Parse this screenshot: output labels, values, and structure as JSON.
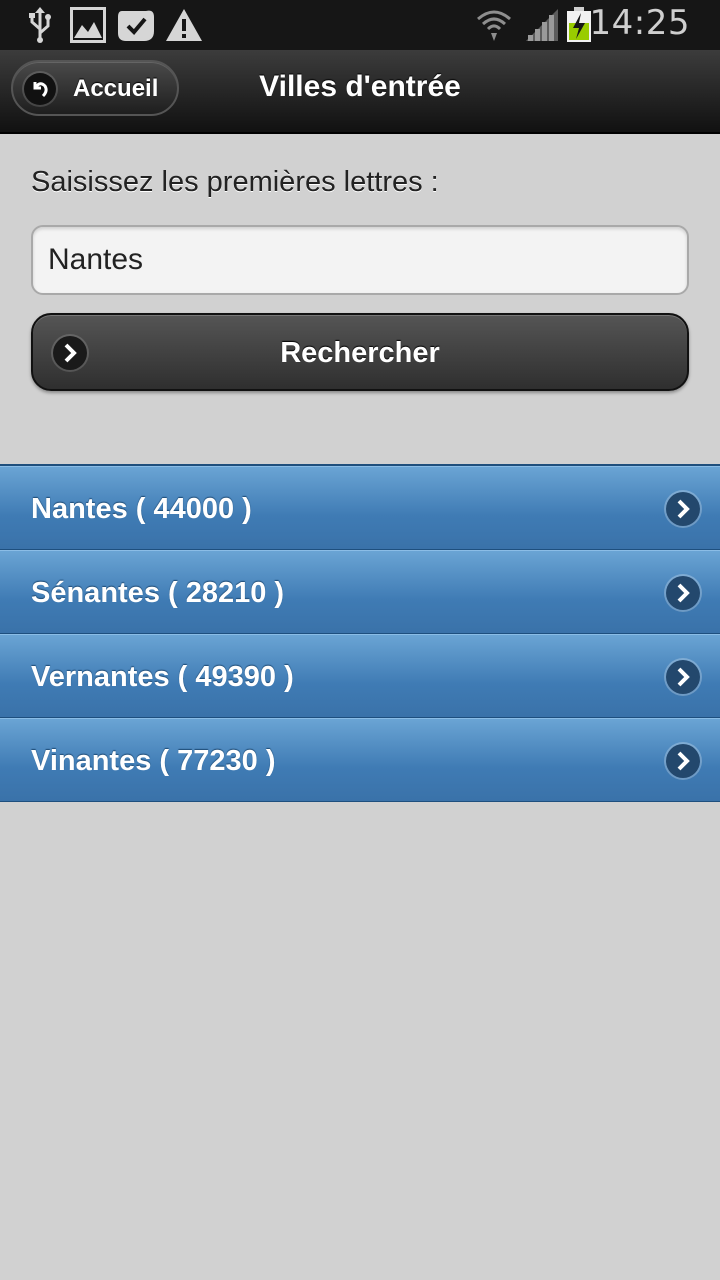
{
  "status_bar": {
    "time": "14:25",
    "icons": [
      "usb-icon",
      "image-icon",
      "check-bubble-icon",
      "warning-icon",
      "wifi-icon",
      "signal-icon",
      "battery-charging-icon"
    ]
  },
  "header": {
    "back_label": "Accueil",
    "title": "Villes d'entrée"
  },
  "search": {
    "prompt": "Saisissez les premières lettres :",
    "value": "Nantes",
    "button_label": "Rechercher"
  },
  "results": [
    {
      "label": "Nantes ( 44000 )"
    },
    {
      "label": "Sénantes ( 28210 )"
    },
    {
      "label": "Vernantes ( 49390 )"
    },
    {
      "label": "Vinantes ( 77230 )"
    }
  ],
  "colors": {
    "list_blue": "#4a86bf",
    "header_dark": "#1e1e1e",
    "background": "#d1d1d1"
  }
}
